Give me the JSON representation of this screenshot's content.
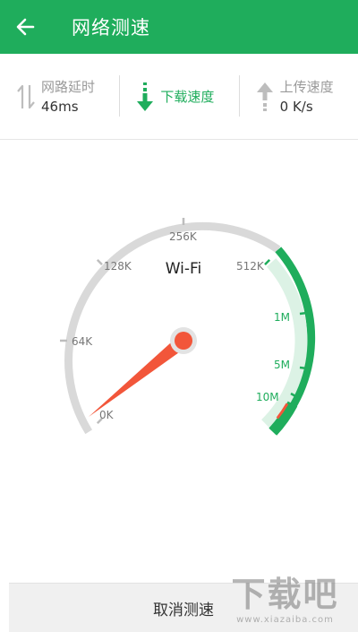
{
  "header": {
    "title": "网络测速",
    "bg_color": "#1fad5c",
    "back_icon": "arrow-left-icon"
  },
  "stats": {
    "latency": {
      "label": "网路延时",
      "value": "46ms",
      "icon": "up-down-arrows-icon"
    },
    "download": {
      "label": "下载速度",
      "value": "",
      "icon": "download-arrow-icon",
      "active": true
    },
    "upload": {
      "label": "上传速度",
      "value": "0 K/s",
      "icon": "upload-arrow-icon"
    }
  },
  "gauge": {
    "network_label": "Wi-Fi",
    "ticks": [
      "0K",
      "64K",
      "128K",
      "256K",
      "512K",
      "1M",
      "5M",
      "10M"
    ],
    "needle_value": "0K",
    "accent_color": "#1fad5c",
    "needle_color": "#f2563a",
    "track_color": "#d9d9d9"
  },
  "footer": {
    "cancel_label": "取消测速"
  },
  "watermark": {
    "big": "下载吧",
    "small": "www.xiazaiba.com"
  }
}
